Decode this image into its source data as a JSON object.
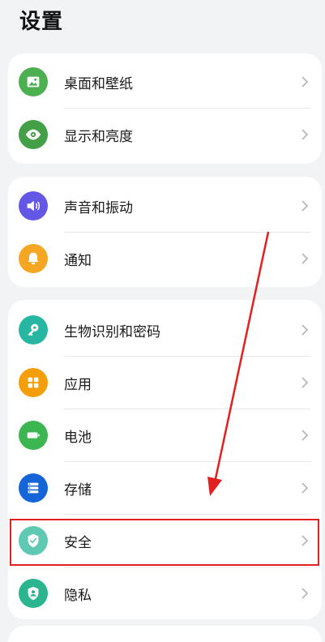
{
  "page": {
    "title": "设置"
  },
  "groups": [
    {
      "items": [
        {
          "label": "桌面和壁纸",
          "icon": "wallpaper-icon",
          "color": "#4caf50"
        },
        {
          "label": "显示和亮度",
          "icon": "eye-icon",
          "color": "#43a047"
        }
      ]
    },
    {
      "items": [
        {
          "label": "声音和振动",
          "icon": "speaker-icon",
          "color": "#6457e6"
        },
        {
          "label": "通知",
          "icon": "bell-icon",
          "color": "#f5a623"
        }
      ]
    },
    {
      "items": [
        {
          "label": "生物识别和密码",
          "icon": "key-icon",
          "color": "#26b6a2"
        },
        {
          "label": "应用",
          "icon": "apps-grid-icon",
          "color": "#f59e0b"
        },
        {
          "label": "电池",
          "icon": "battery-icon",
          "color": "#3cb650"
        },
        {
          "label": "存储",
          "icon": "storage-icon",
          "color": "#1565d8"
        },
        {
          "label": "安全",
          "icon": "shield-check-icon",
          "color": "#5fc9b3"
        },
        {
          "label": "隐私",
          "icon": "privacy-shield-icon",
          "color": "#2bb58f"
        }
      ]
    }
  ],
  "annotation": {
    "highlight_color": "#e32020"
  }
}
